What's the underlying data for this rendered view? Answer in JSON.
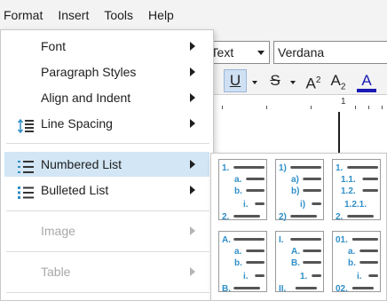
{
  "menubar": {
    "items": [
      "Format",
      "Insert",
      "Tools",
      "Help"
    ]
  },
  "toolbar": {
    "style_value": "al Text",
    "font_value": "Verdana",
    "buttons": {
      "underline": "U",
      "strike": "S",
      "superscript": "A",
      "superscript_mark": "2",
      "subscript": "A",
      "subscript_mark": "2",
      "font_color": "A"
    },
    "accent_color": "#1a1ab4"
  },
  "ruler": {
    "label": "1"
  },
  "format_menu": {
    "items": [
      {
        "label": "Font",
        "icon": "",
        "has_submenu": true,
        "enabled": true
      },
      {
        "label": "Paragraph Styles",
        "icon": "",
        "has_submenu": true,
        "enabled": true
      },
      {
        "label": "Align and Indent",
        "icon": "",
        "has_submenu": true,
        "enabled": true
      },
      {
        "label": "Line Spacing",
        "icon": "line-spacing-icon",
        "has_submenu": true,
        "enabled": true
      },
      {
        "label": "Numbered List",
        "icon": "numbered-list-icon",
        "has_submenu": true,
        "enabled": true,
        "highlighted": true
      },
      {
        "label": "Bulleted List",
        "icon": "bulleted-list-icon",
        "has_submenu": true,
        "enabled": true
      },
      {
        "label": "Image",
        "icon": "",
        "has_submenu": true,
        "enabled": false
      },
      {
        "label": "Table",
        "icon": "",
        "has_submenu": true,
        "enabled": false
      }
    ],
    "highlight_color": "#d2e6f5",
    "icon_accent": "#2f8fc8"
  },
  "numbered_list_submenu": {
    "presets": [
      {
        "name": "numeric-letter-roman",
        "labels": [
          "1.",
          "a.",
          "b.",
          "i.",
          "2."
        ]
      },
      {
        "name": "parenthesis",
        "labels": [
          "1)",
          "a)",
          "b)",
          "i)",
          "2)"
        ]
      },
      {
        "name": "decimal-outline",
        "labels": [
          "1.",
          "1.1.",
          "1.2.",
          "1.2.1.",
          "2."
        ]
      },
      {
        "name": "upper-letter",
        "labels": [
          "A.",
          "a.",
          "b.",
          "i.",
          "B."
        ]
      },
      {
        "name": "upper-roman",
        "labels": [
          "I.",
          "A.",
          "B.",
          "1.",
          "II."
        ]
      },
      {
        "name": "leading-zero",
        "labels": [
          "01.",
          "a.",
          "b.",
          "i.",
          "02."
        ]
      }
    ],
    "label_color": "#2f8fc8",
    "line_color": "#555555"
  }
}
